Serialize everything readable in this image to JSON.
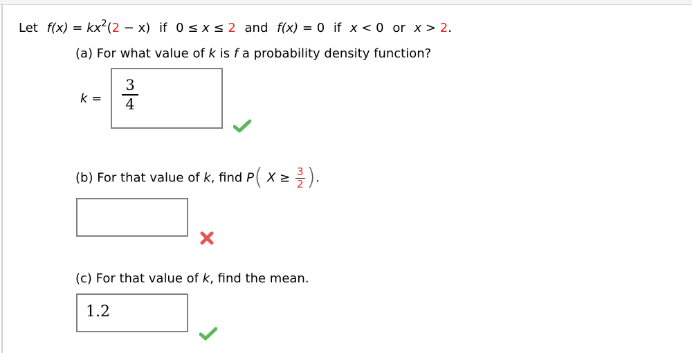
{
  "problem": {
    "intro": {
      "let": "Let",
      "fx": "f(x)",
      "eq": "=",
      "k": "k",
      "x": "x",
      "exp": "2",
      "open": "(",
      "two_red": "2",
      "minus_x": "− x)",
      "if": "if",
      "zero": "0",
      "le": "≤",
      "and": "and",
      "fx2": "f(x)",
      "eq_zero": "= 0",
      "if2": "if",
      "lt": "< 0",
      "or": "or",
      "gt": ">",
      "period": "."
    },
    "part_a": {
      "question_prefix": "(a) For what value of ",
      "k": "k",
      "is": " is ",
      "f": "f",
      "question_suffix": " a probability density function?",
      "label_k": "k",
      "label_eq": "=",
      "answer": {
        "numerator": "3",
        "denominator": "4"
      },
      "status": "correct"
    },
    "part_b": {
      "question_prefix": "(b) For that value of ",
      "k": "k",
      "question_mid": ", find ",
      "P": "P",
      "X": "X",
      "ge": "≥",
      "frac_num": "3",
      "frac_den": "2",
      "period": ".",
      "answer": "",
      "status": "incorrect"
    },
    "part_c": {
      "question_prefix": "(c) For that value of ",
      "k": "k",
      "question_suffix": ", find the mean.",
      "answer": "1.2",
      "status": "correct"
    }
  },
  "colors": {
    "accent_red": "#e8281f",
    "correct_green": "#5cb85c",
    "incorrect_red": "#e45555",
    "input_border": "#808080"
  },
  "icons": {
    "correct": "check-mark-icon",
    "incorrect": "x-mark-icon"
  }
}
